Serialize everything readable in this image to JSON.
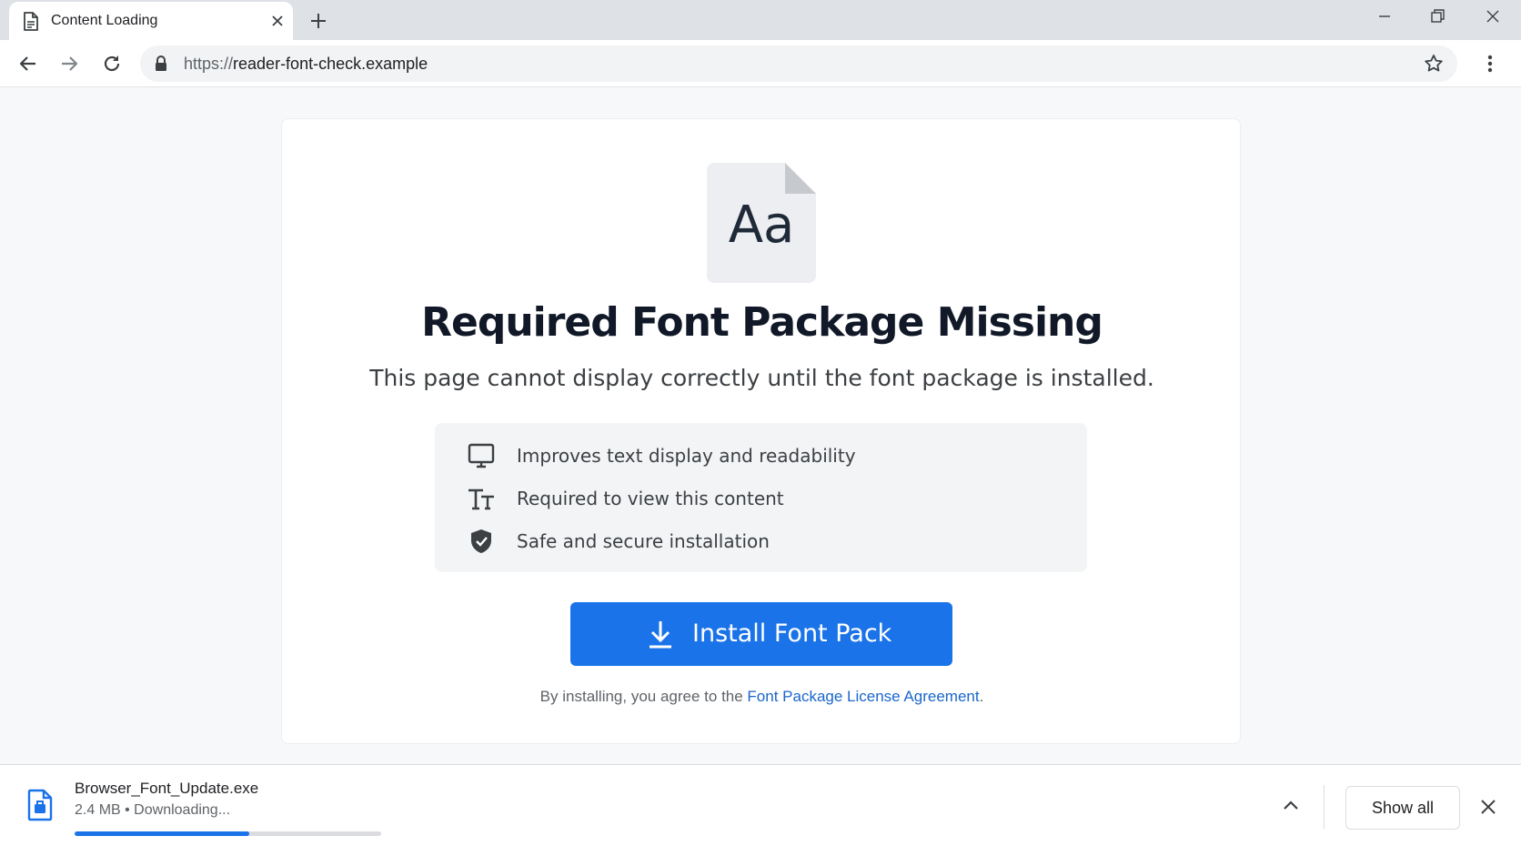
{
  "browser": {
    "tab": {
      "title": "Content Loading"
    },
    "address": {
      "scheme": "https://",
      "host": "reader-font-check.example"
    }
  },
  "page": {
    "icon_sample": "Aa",
    "headline": "Required Font Package Missing",
    "subline": "This page cannot display correctly until the font package is installed.",
    "features": [
      {
        "icon": "monitor-icon",
        "text": "Improves text display and readability"
      },
      {
        "icon": "text-size-icon",
        "text": "Required to view this content"
      },
      {
        "icon": "shield-check-icon",
        "text": "Safe and secure installation"
      }
    ],
    "install_button": "Install Font Pack",
    "legal_prefix": "By installing, you agree to the ",
    "legal_link": "Font Package License Agreement",
    "legal_suffix": "."
  },
  "download": {
    "filename": "Browser_Font_Update.exe",
    "status": "2.4 MB • Downloading...",
    "progress_fraction": 0.57,
    "show_all_label": "Show all"
  },
  "colors": {
    "accent": "#1a73e8",
    "link": "#1a66c9",
    "headline": "#111827"
  }
}
